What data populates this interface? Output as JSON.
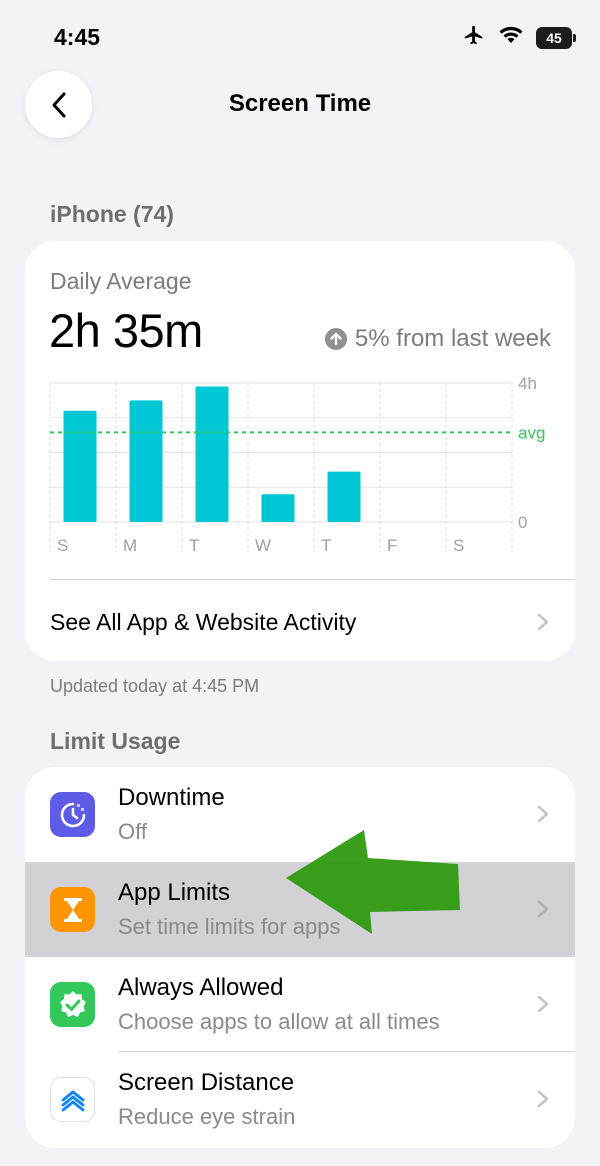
{
  "status_bar": {
    "time": "4:45",
    "battery": "45",
    "icons": [
      "airplane-icon",
      "wifi-icon",
      "battery-icon"
    ]
  },
  "nav": {
    "title": "Screen Time",
    "back_icon": "chevron-left-icon"
  },
  "device_section": {
    "header": "iPhone (74)"
  },
  "summary": {
    "label": "Daily Average",
    "value": "2h 35m",
    "delta_text": "5% from last week",
    "delta_icon": "arrow-up-circle-icon",
    "activity_link": "See All App & Website Activity",
    "updated": "Updated today at 4:45 PM"
  },
  "chart_data": {
    "type": "bar",
    "categories": [
      "S",
      "M",
      "T",
      "W",
      "T",
      "F",
      "S"
    ],
    "values": [
      3.2,
      3.5,
      3.9,
      0.8,
      1.45,
      0,
      0
    ],
    "ylim": [
      0,
      4
    ],
    "y_ticks": [
      "4h",
      "avg",
      "0"
    ],
    "avg_value": 2.58,
    "bar_color": "#00c7d4",
    "avg_color": "#34c759",
    "grid": true
  },
  "limit_section": {
    "header": "Limit Usage",
    "items": [
      {
        "title": "Downtime",
        "subtitle": "Off",
        "icon": "downtime-icon",
        "color": "#5e5ce6"
      },
      {
        "title": "App Limits",
        "subtitle": "Set time limits for apps",
        "icon": "hourglass-icon",
        "color": "#ff9500"
      },
      {
        "title": "Always Allowed",
        "subtitle": "Choose apps to allow at all times",
        "icon": "checkmark-badge-icon",
        "color": "#34c759"
      },
      {
        "title": "Screen Distance",
        "subtitle": "Reduce eye strain",
        "icon": "screen-distance-icon",
        "color": "#007aff"
      }
    ]
  },
  "annotation": {
    "arrow_color": "#2f9a10",
    "arrow_icon": "green-arrow-annotation"
  }
}
